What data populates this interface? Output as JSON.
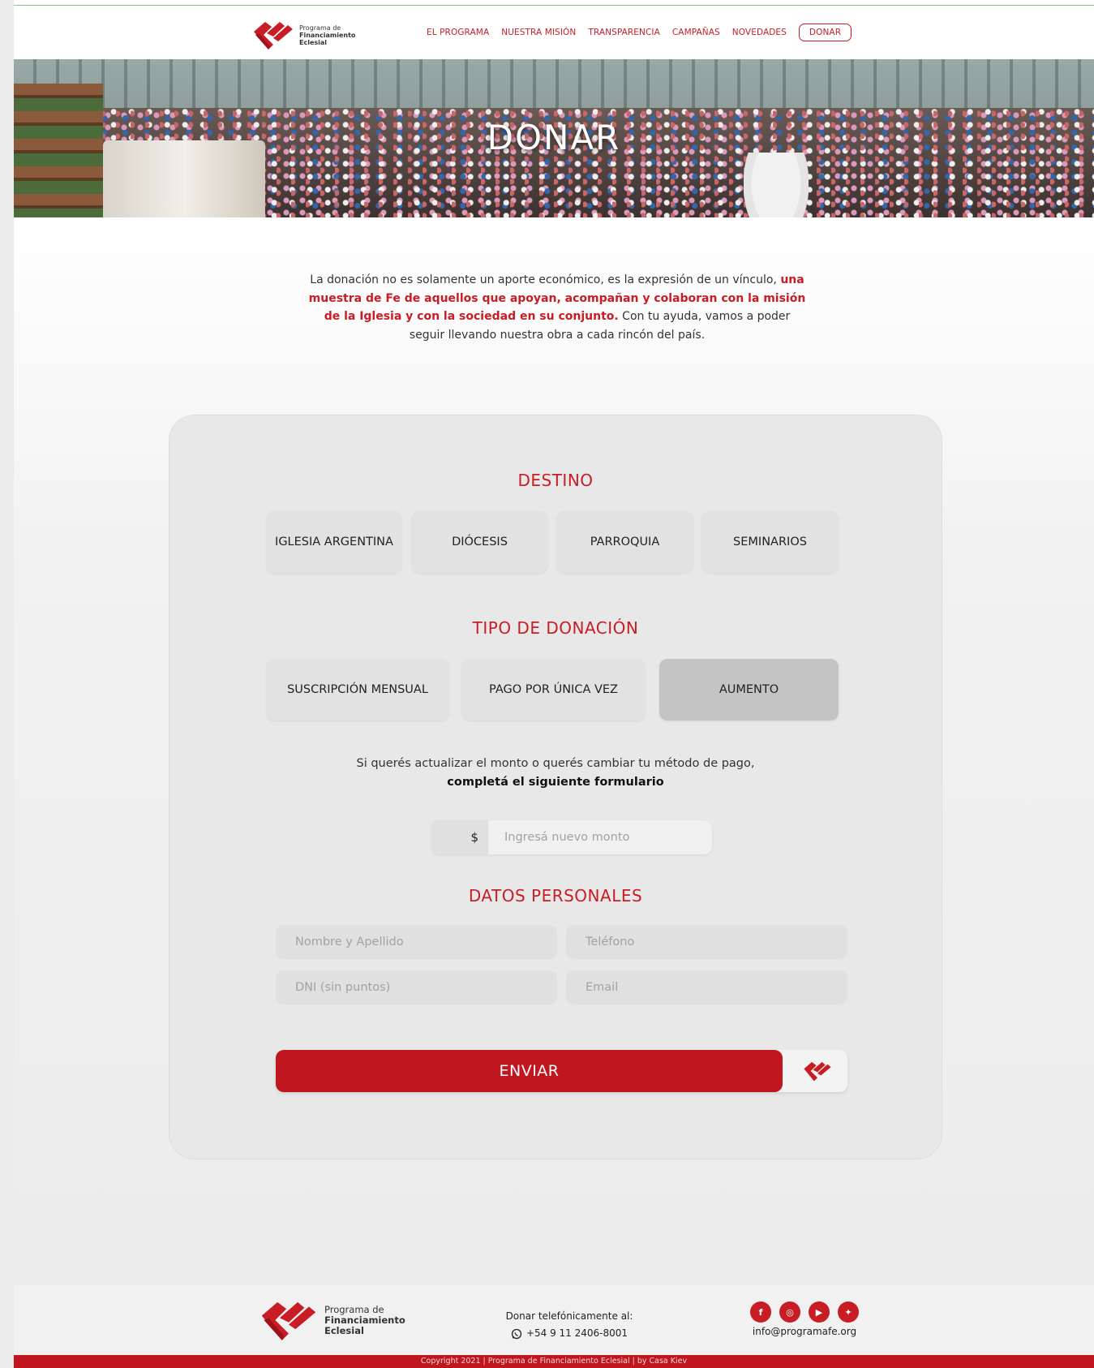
{
  "brand": {
    "line1": "Programa de",
    "line2": "Financiamiento",
    "line3": "Eclesial",
    "red": "#c81d25"
  },
  "nav": {
    "items": [
      "EL PROGRAMA",
      "NUESTRA MISIÓN",
      "TRANSPARENCIA",
      "CAMPAÑAS",
      "NOVEDADES"
    ],
    "donate": "DONAR"
  },
  "hero": {
    "title": "DONAR"
  },
  "intro": {
    "part1": "La donación no es solamente un aporte económico, es la expresión de un vínculo,",
    "highlight": "una muestra de Fe de aquellos que apoyan, acompañan y colaboran con la misión de la Iglesia y con la sociedad en su conjunto.",
    "part2": "Con tu ayuda, vamos a poder seguir llevando nuestra obra a cada rincón del país."
  },
  "form": {
    "destino": {
      "title": "DESTINO",
      "options": [
        "IGLESIA ARGENTINA",
        "DIÓCESIS",
        "PARROQUIA",
        "SEMINARIOS"
      ]
    },
    "tipo": {
      "title": "TIPO DE DONACIÓN",
      "options": [
        "SUSCRIPCIÓN MENSUAL",
        "PAGO POR ÚNICA VEZ",
        "AUMENTO"
      ],
      "selected": "AUMENTO"
    },
    "note": {
      "line1": "Si querés actualizar el monto o querés cambiar tu método de pago,",
      "line2": "completá el siguiente formulario"
    },
    "amount": {
      "currency": "$",
      "placeholder": "Ingresá nuevo monto",
      "value": ""
    },
    "personal": {
      "title": "DATOS PERSONALES",
      "name_placeholder": "Nombre y Apellido",
      "phone_placeholder": "Teléfono",
      "dni_placeholder": "DNI (sin puntos)",
      "email_placeholder": "Email"
    },
    "submit": "ENVIAR"
  },
  "footer": {
    "phone_label": "Donar telefónicamente al:",
    "phone": "+54 9 11 2406-8001",
    "email": "info@programafe.org",
    "social_icons": [
      "facebook-icon",
      "instagram-icon",
      "youtube-icon",
      "twitter-icon"
    ],
    "copyright": "Copyright 2021 | Programa de Financiamiento Eclesial | by Casa Kiev"
  }
}
